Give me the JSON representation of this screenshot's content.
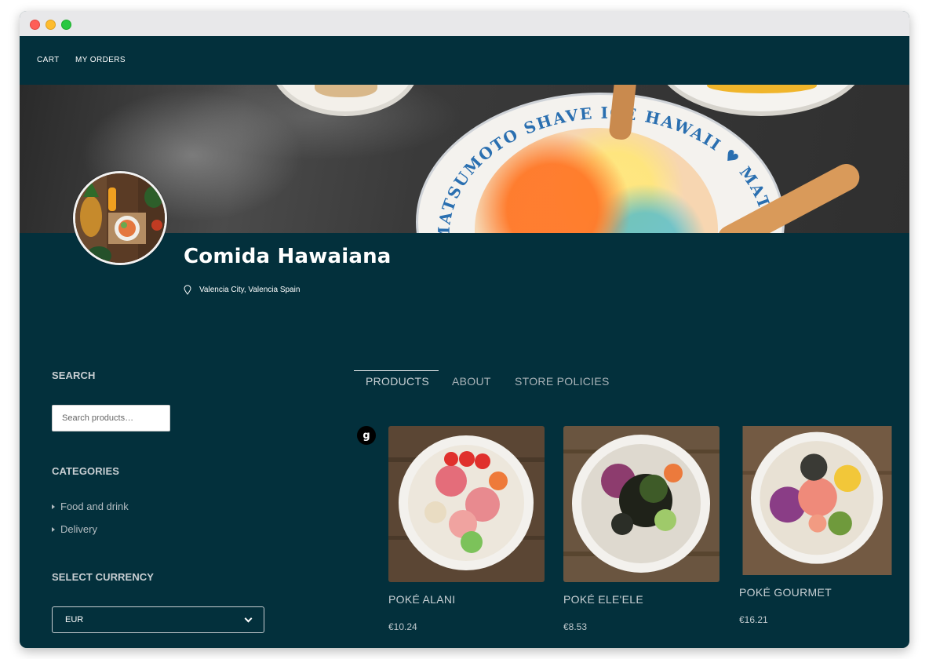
{
  "nav": {
    "cart_label": "CART",
    "orders_label": "MY ORDERS"
  },
  "banner": {
    "bowl_text": "MATSUMOTO SHAVE ICE HAWAII ♥ MATSUMOTO"
  },
  "store": {
    "name": "Comida Hawaiana",
    "location": "Valencia City, Valencia Spain"
  },
  "sidebar": {
    "search_heading": "SEARCH",
    "search_placeholder": "Search products…",
    "categories_heading": "CATEGORIES",
    "categories": [
      {
        "label": "Food and drink"
      },
      {
        "label": "Delivery"
      }
    ],
    "currency_heading": "SELECT CURRENCY",
    "currency_value": "EUR"
  },
  "tabs": [
    {
      "label": "PRODUCTS",
      "active": true
    },
    {
      "label": "ABOUT",
      "active": false
    },
    {
      "label": "STORE POLICIES",
      "active": false
    }
  ],
  "badge": {
    "text": "g"
  },
  "products": [
    {
      "name": "POKÉ ALANI",
      "price": "€10.24"
    },
    {
      "name": "POKÉ ELE'ELE",
      "price": "€8.53"
    },
    {
      "name": "POKÉ GOURMET",
      "price": "€16.21"
    }
  ],
  "colors": {
    "page_background": "#03303c",
    "window_chrome": "#e8e8ea",
    "text_primary": "#ffffff",
    "text_muted": "#c8d0d4"
  },
  "icons": {
    "location": "map-pin-icon",
    "category_bullet": "triangle-right-icon",
    "select_arrow": "chevron-down-icon"
  }
}
